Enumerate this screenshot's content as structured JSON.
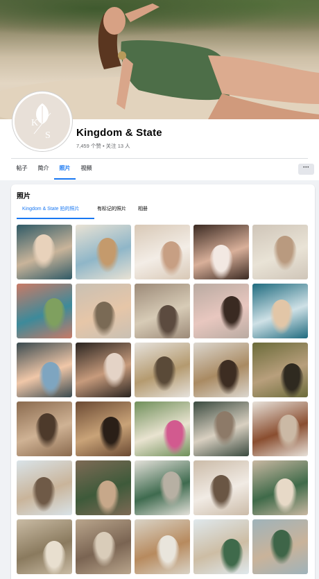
{
  "profile": {
    "name": "Kingdom & State",
    "likes_label": "7,459 个赞",
    "separator": " • ",
    "following_label": "关注 13 人",
    "avatar_monogram_left": "K",
    "avatar_monogram_right": "S"
  },
  "nav": {
    "tabs": [
      {
        "label": "帖子",
        "active": false
      },
      {
        "label": "简介",
        "active": false
      },
      {
        "label": "照片",
        "active": true
      },
      {
        "label": "视频",
        "active": false
      }
    ],
    "more_label": "···"
  },
  "photos_section": {
    "title": "照片",
    "subtabs": [
      {
        "label": "Kingdom & State 拍的照片",
        "active": true
      },
      {
        "label": "有标记的照片",
        "active": false
      },
      {
        "label": "相册",
        "active": false
      }
    ],
    "photos": [
      {
        "subject": "woman-sitting-beach",
        "colors": [
          "#2f5a66",
          "#c9b49a",
          "#e8d2bb"
        ]
      },
      {
        "subject": "arched-window-sea-view",
        "colors": [
          "#e9e2d4",
          "#8fb6c8",
          "#c49a6c"
        ]
      },
      {
        "subject": "woman-lying-white-swimsuit",
        "colors": [
          "#d8c8b6",
          "#f3ede6",
          "#c79f83"
        ]
      },
      {
        "subject": "woman-floral-bikini",
        "colors": [
          "#3b2a22",
          "#d9b09a",
          "#f2e8e2"
        ]
      },
      {
        "subject": "woman-cream-swimsuit",
        "colors": [
          "#cfc5b8",
          "#e9e3d6",
          "#b99a7f"
        ]
      },
      {
        "subject": "villa-pool-umbrella",
        "colors": [
          "#c97a66",
          "#3d8a9a",
          "#7fa05f"
        ]
      },
      {
        "subject": "blonde-woman-pool-edge",
        "colors": [
          "#c9c0b3",
          "#e6c6a8",
          "#7a6a55"
        ]
      },
      {
        "subject": "woman-sitting-cream-bikini",
        "colors": [
          "#9c8a78",
          "#d7cbb6",
          "#5c4b3f"
        ]
      },
      {
        "subject": "curly-hair-woman-pink-bikini",
        "colors": [
          "#b9aaa1",
          "#e8c7bf",
          "#3a2a22"
        ]
      },
      {
        "subject": "woman-pool-white-swimsuit",
        "colors": [
          "#1f6b7f",
          "#cfe1e6",
          "#e2c6a7"
        ]
      },
      {
        "subject": "balcony-doors-sunset",
        "colors": [
          "#3a4a4f",
          "#f0c7a8",
          "#7ea5c0"
        ]
      },
      {
        "subject": "woman-black-bikini",
        "colors": [
          "#2a2420",
          "#c79b7c",
          "#e4d3c6"
        ]
      },
      {
        "subject": "leopard-bikini-flatlay",
        "colors": [
          "#e6e2dc",
          "#b49a6f",
          "#5a4a38"
        ]
      },
      {
        "subject": "woman-leopard-bikini-white-wall",
        "colors": [
          "#dcd7cf",
          "#a98a62",
          "#3d2d22"
        ]
      },
      {
        "subject": "woman-leopard-swimsuit-garden",
        "colors": [
          "#6b6b3a",
          "#b89f7c",
          "#2f2a20"
        ]
      },
      {
        "subject": "woman-rocks-bikini",
        "colors": [
          "#8a6a4e",
          "#cfb294",
          "#4d3a2b"
        ]
      },
      {
        "subject": "leopard-swimsuit-closeup",
        "colors": [
          "#6b4a33",
          "#c9a378",
          "#2a1f17"
        ]
      },
      {
        "subject": "duck-with-flower-crown",
        "colors": [
          "#6f8f5a",
          "#e9e3d0",
          "#d25a8f"
        ]
      },
      {
        "subject": "cafe-table-cups",
        "colors": [
          "#3a4a3f",
          "#d9d0c1",
          "#8d7a68"
        ]
      },
      {
        "subject": "poodle-with-swimsuit",
        "colors": [
          "#e8e2da",
          "#8a4e30",
          "#cbb9a5"
        ]
      },
      {
        "subject": "woman-beach-waves",
        "colors": [
          "#d9e3e8",
          "#c9b49a",
          "#6f5a47"
        ]
      },
      {
        "subject": "woman-green-floral-swimsuit",
        "colors": [
          "#7d6a55",
          "#3e5a3a",
          "#c7a88a"
        ]
      },
      {
        "subject": "green-bikini-flatlay",
        "colors": [
          "#e4e1da",
          "#3f6b4f",
          "#b7b0a3"
        ]
      },
      {
        "subject": "woman-white-swimsuit-sitting",
        "colors": [
          "#cbbba8",
          "#f1ebe4",
          "#6a5644"
        ]
      },
      {
        "subject": "woman-green-bikini-beach",
        "colors": [
          "#c9b8a2",
          "#3f6a49",
          "#e7d9c7"
        ]
      },
      {
        "subject": "beach-towel-hat",
        "colors": [
          "#c9bba4",
          "#8a7a5e",
          "#e8dfcf"
        ]
      },
      {
        "subject": "woman-rooftop-picnic",
        "colors": [
          "#b9a58c",
          "#7a6452",
          "#d9ccb9"
        ]
      },
      {
        "subject": "picnic-plate-food",
        "colors": [
          "#d9d3c6",
          "#b78a5e",
          "#e9e5dc"
        ]
      },
      {
        "subject": "woman-walking-beach",
        "colors": [
          "#dfe8ec",
          "#cdbda4",
          "#3f6a4b"
        ]
      },
      {
        "subject": "woman-green-swimsuit-sea",
        "colors": [
          "#9fb3ba",
          "#c9b39a",
          "#3e6548"
        ]
      }
    ]
  },
  "icons": {
    "more": "more-dots-icon",
    "avatar_leaf": "leaf-icon"
  }
}
